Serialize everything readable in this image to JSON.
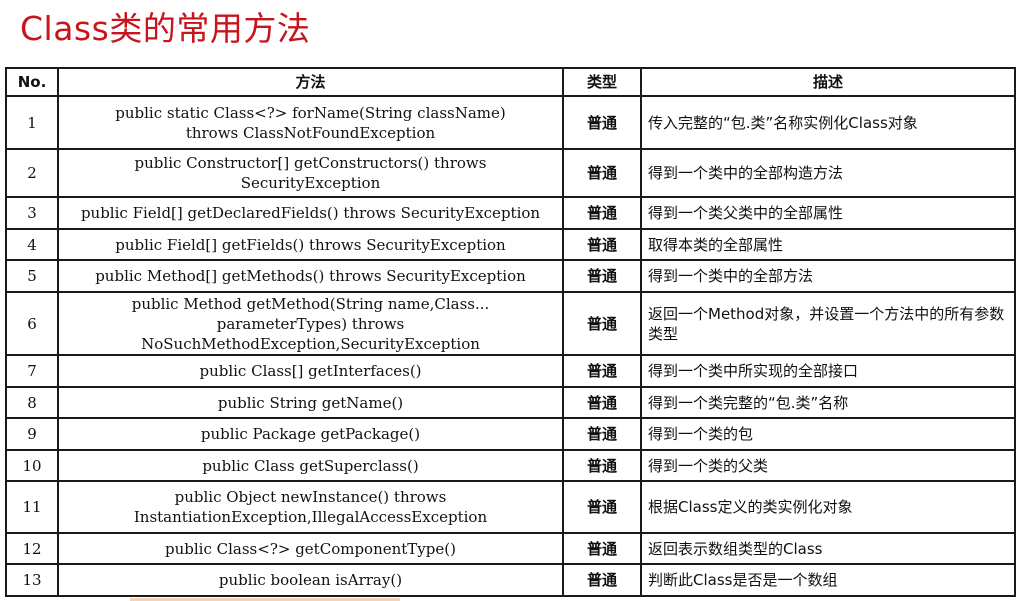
{
  "title": "Class类的常用方法",
  "headers": {
    "no": "No.",
    "method": "方法",
    "type": "类型",
    "desc": "描述"
  },
  "rows": [
    {
      "no": "1",
      "method": "public static Class<?> forName(String className) throws ClassNotFoundException",
      "type": "普通",
      "desc": "传入完整的“包.类”名称实例化Class对象"
    },
    {
      "no": "2",
      "method": "public Constructor[] getConstructors() throws SecurityException",
      "type": "普通",
      "desc": "得到一个类中的全部构造方法"
    },
    {
      "no": "3",
      "method": "public Field[] getDeclaredFields() throws SecurityException",
      "type": "普通",
      "desc": "得到一个类父类中的全部属性"
    },
    {
      "no": "4",
      "method": "public Field[] getFields() throws SecurityException",
      "type": "普通",
      "desc": "取得本类的全部属性"
    },
    {
      "no": "5",
      "method": "public Method[] getMethods() throws SecurityException",
      "type": "普通",
      "desc": "得到一个类中的全部方法"
    },
    {
      "no": "6",
      "method": "public Method getMethod(String name,Class... parameterTypes) throws NoSuchMethodException,SecurityException",
      "type": "普通",
      "desc": "返回一个Method对象，并设置一个方法中的所有参数类型"
    },
    {
      "no": "7",
      "method": "public Class[] getInterfaces()",
      "type": "普通",
      "desc": "得到一个类中所实现的全部接口"
    },
    {
      "no": "8",
      "method": "public String getName()",
      "type": "普通",
      "desc": "得到一个类完整的“包.类”名称"
    },
    {
      "no": "9",
      "method": "public Package getPackage()",
      "type": "普通",
      "desc": "得到一个类的包"
    },
    {
      "no": "10",
      "method": "public Class getSuperclass()",
      "type": "普通",
      "desc": "得到一个类的父类"
    },
    {
      "no": "11",
      "method": "public Object newInstance() throws InstantiationException,IllegalAccessException",
      "type": "普通",
      "desc": "根据Class定义的类实例化对象"
    },
    {
      "no": "12",
      "method": "public Class<?> getComponentType()",
      "type": "普通",
      "desc": "返回表示数组类型的Class"
    },
    {
      "no": "13",
      "method": "public boolean isArray()",
      "type": "普通",
      "desc": "判断此Class是否是一个数组"
    }
  ],
  "colors": {
    "title": "#c8141c",
    "border": "#1a1a1a"
  }
}
